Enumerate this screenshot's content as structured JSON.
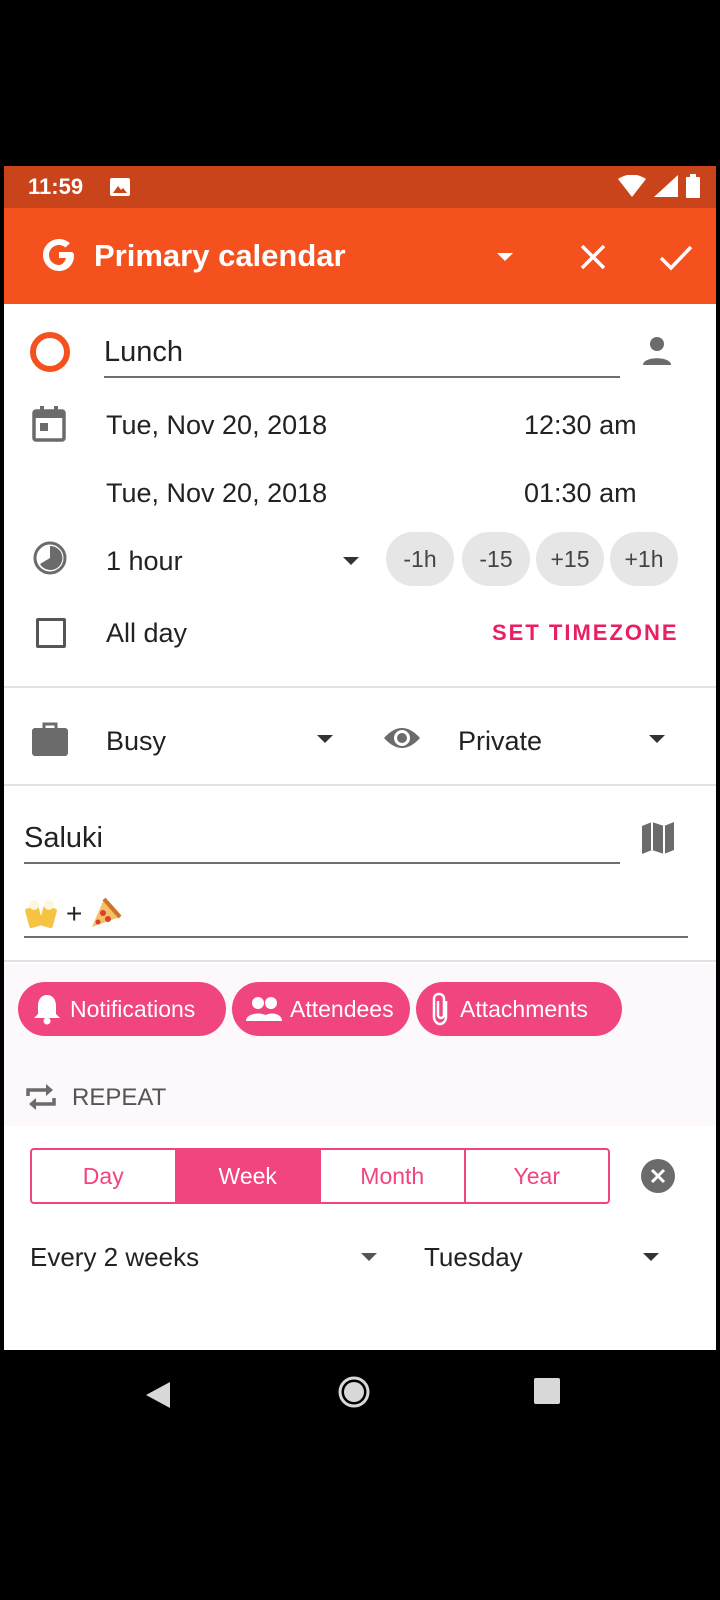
{
  "status_bar": {
    "time": "11:59"
  },
  "app_bar": {
    "title": "Primary calendar"
  },
  "event": {
    "title": "Lunch",
    "start_date": "Tue, Nov 20, 2018",
    "start_time": "12:30 am",
    "end_date": "Tue, Nov 20, 2018",
    "end_time": "01:30 am",
    "duration": "1 hour",
    "duration_chips": [
      "-1h",
      "-15",
      "+15",
      "+1h"
    ],
    "all_day_label": "All day",
    "set_timezone_label": "SET TIMEZONE",
    "availability": "Busy",
    "visibility": "Private",
    "location": "Saluki",
    "description_plus": "+"
  },
  "actions": {
    "notifications": "Notifications",
    "attendees": "Attendees",
    "attachments": "Attachments"
  },
  "repeat": {
    "label": "REPEAT",
    "segments": [
      "Day",
      "Week",
      "Month",
      "Year"
    ],
    "selected": "Week",
    "frequency": "Every 2 weeks",
    "weekday": "Tuesday"
  },
  "colors": {
    "status_bar": "#c9431b",
    "app_bar": "#f4511e",
    "accent": "#f0457e"
  }
}
